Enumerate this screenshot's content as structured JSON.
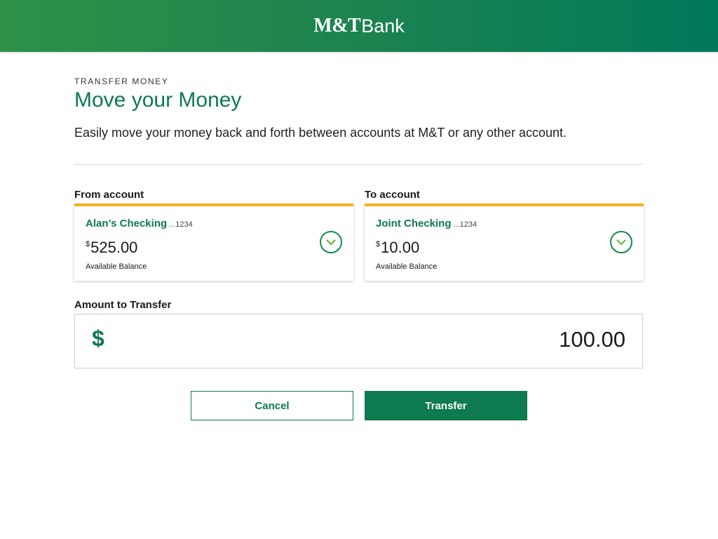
{
  "header": {
    "logo_bold": "M&T",
    "logo_light": "Bank"
  },
  "page": {
    "eyebrow": "TRANSFER MONEY",
    "title": "Move your Money",
    "subtitle": "Easily move your money back and forth between accounts at M&T or any other account."
  },
  "from_account": {
    "section_label": "From account",
    "name": "Alan’s Checking",
    "number": "...1234",
    "currency_symbol": "$",
    "balance": "525.00",
    "balance_label": "Available Balance"
  },
  "to_account": {
    "section_label": "To account",
    "name": "Joint Checking",
    "number": "...1234",
    "currency_symbol": "$",
    "balance": "10.00",
    "balance_label": "Available Balance"
  },
  "amount": {
    "label": "Amount to Transfer",
    "currency_symbol": "$",
    "value": "100.00"
  },
  "actions": {
    "cancel_label": "Cancel",
    "transfer_label": "Transfer"
  },
  "icons": {
    "dropdown": "chevron-down-icon"
  },
  "colors": {
    "brand_green": "#0d7a4f",
    "accent_yellow": "#f5b21b",
    "header_gradient_start": "#2e9147",
    "header_gradient_end": "#00795a"
  }
}
